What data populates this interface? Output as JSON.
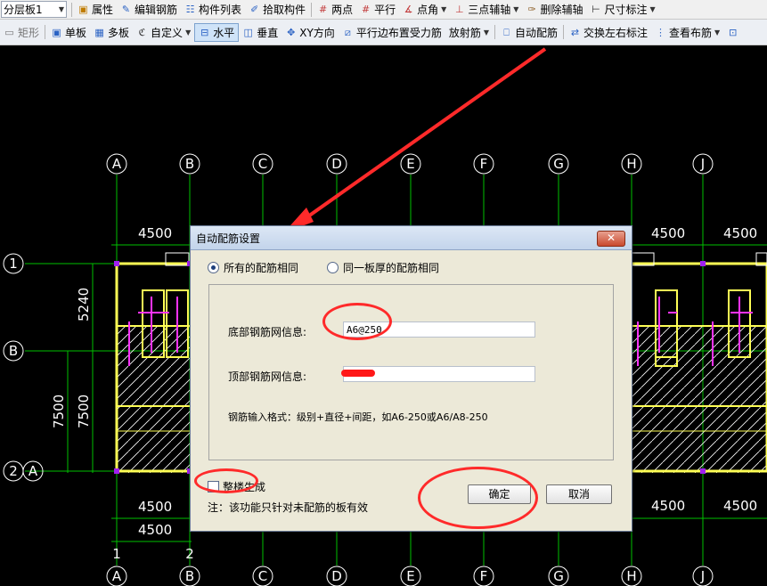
{
  "toolbar1": {
    "layer_select": "分层板1",
    "items": [
      {
        "label": "属性",
        "icon": "properties-icon"
      },
      {
        "label": "编辑钢筋",
        "icon": "edit-rebar-icon"
      },
      {
        "label": "构件列表",
        "icon": "component-list-icon"
      },
      {
        "label": "拾取构件",
        "icon": "pick-component-icon"
      },
      {
        "label": "两点",
        "icon": "two-point-axis-icon"
      },
      {
        "label": "平行",
        "icon": "parallel-axis-icon"
      },
      {
        "label": "点角",
        "icon": "point-angle-icon"
      },
      {
        "label": "三点辅轴",
        "icon": "three-point-axis-icon"
      },
      {
        "label": "删除辅轴",
        "icon": "delete-axis-icon"
      },
      {
        "label": "尺寸标注",
        "icon": "dimension-icon"
      }
    ]
  },
  "toolbar2": {
    "items": [
      {
        "label": "矩形",
        "icon": "rectangle-icon"
      },
      {
        "label": "单板",
        "icon": "single-slab-icon"
      },
      {
        "label": "多板",
        "icon": "multi-slab-icon"
      },
      {
        "label": "自定义",
        "icon": "custom-icon"
      },
      {
        "label": "水平",
        "icon": "horizontal-icon"
      },
      {
        "label": "垂直",
        "icon": "vertical-icon"
      },
      {
        "label": "XY方向",
        "icon": "xy-direction-icon"
      },
      {
        "label": "平行边布置受力筋",
        "icon": "parallel-edge-rebar-icon"
      },
      {
        "label": "放射筋",
        "icon": "radial-rebar-icon"
      },
      {
        "label": "自动配筋",
        "icon": "auto-rebar-icon"
      },
      {
        "label": "交换左右标注",
        "icon": "swap-label-icon"
      },
      {
        "label": "查看布筋",
        "icon": "view-rebar-icon"
      }
    ]
  },
  "canvas": {
    "col_axes": [
      "A",
      "B",
      "C",
      "D",
      "E",
      "F",
      "G",
      "H",
      "J"
    ],
    "row_axes_left": [
      "1",
      "B",
      "2"
    ],
    "row_axis_2_extra": "A",
    "dims_top": [
      "4500",
      "4500",
      "4500"
    ],
    "dims_bottom": [
      "4500",
      "4500",
      "4500",
      "4500"
    ],
    "dims_left": [
      "5240",
      "7500",
      "7500"
    ],
    "bottom_axes_extra": [
      "1",
      "2"
    ]
  },
  "dialog": {
    "title": "自动配筋设置",
    "close_glyph": "✕",
    "option_all_same": "所有的配筋相同",
    "option_same_thickness": "同一板厚的配筋相同",
    "bottom_label": "底部钢筋网信息:",
    "bottom_value": "A6@250",
    "top_label": "顶部钢筋网信息:",
    "top_value": "",
    "format_hint": "钢筋输入格式：级别+直径+间距，如A6-250或A6/A8-250",
    "whole_building_label": "整楼生成",
    "note": "注：该功能只针对未配筋的板有效",
    "ok_label": "确定",
    "cancel_label": "取消"
  },
  "colors": {
    "annotation": "#ff2a2a",
    "axis_line": "#00c000",
    "slab_edge": "#ffff55",
    "rebar": "#ff33ff"
  }
}
